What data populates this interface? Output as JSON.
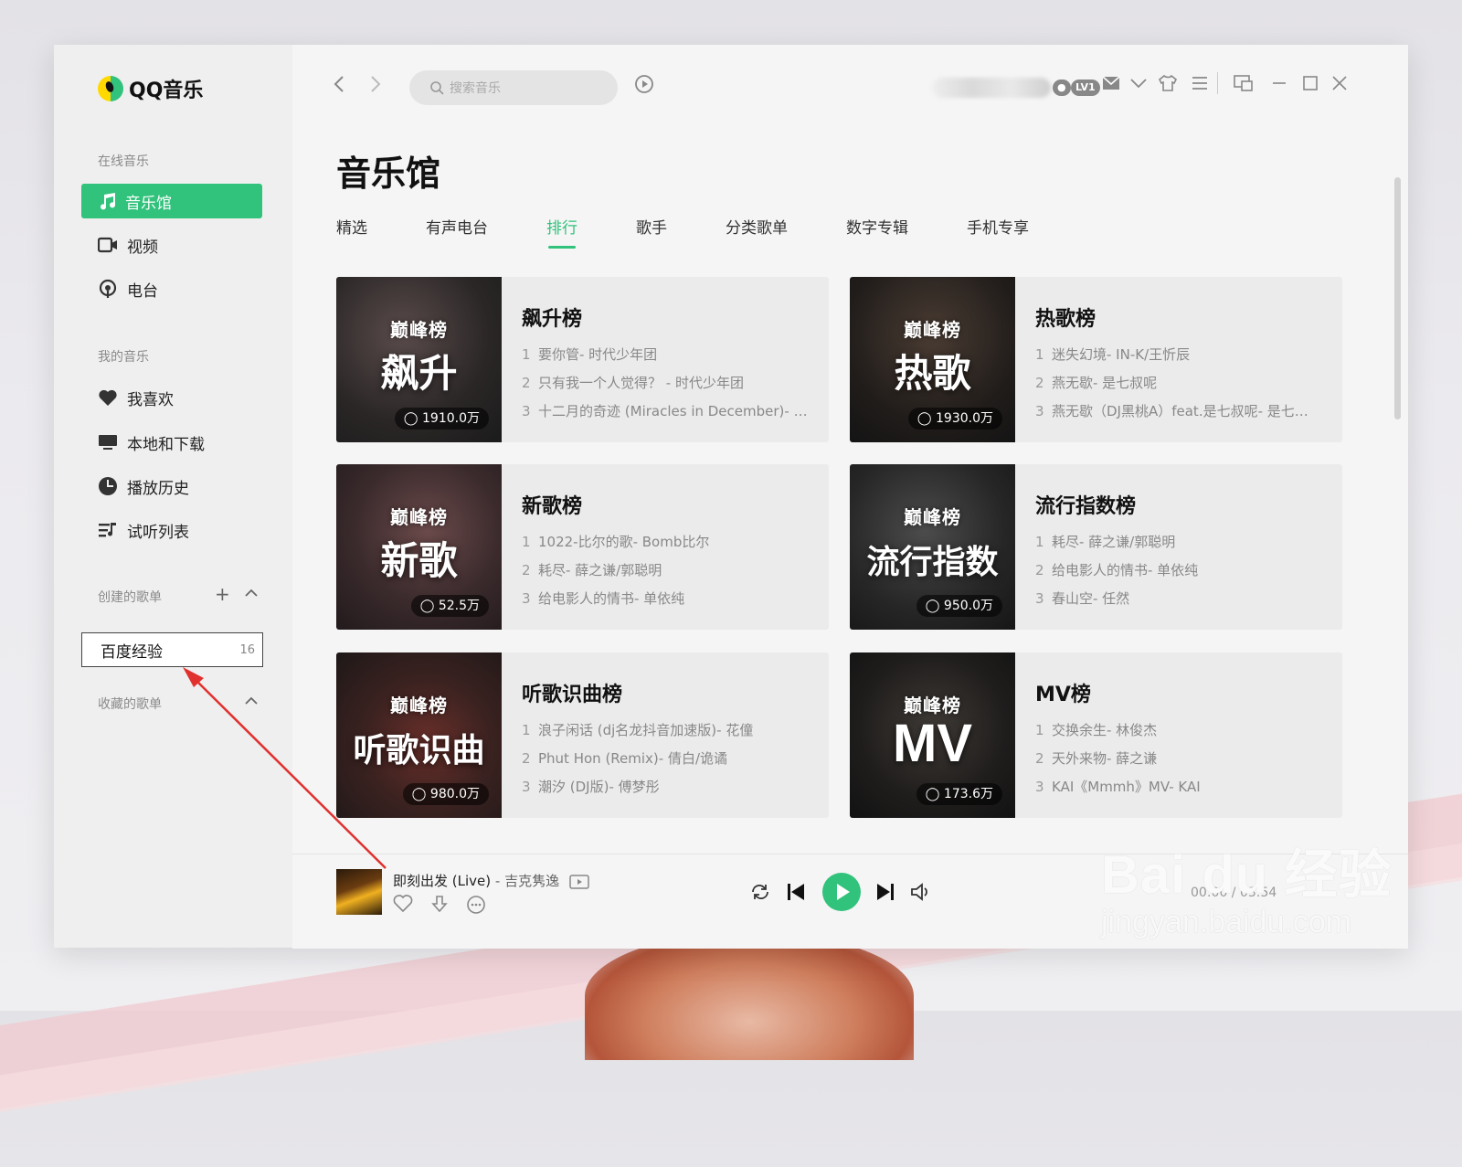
{
  "app": {
    "name": "QQ音乐"
  },
  "sidebar": {
    "online_title": "在线音乐",
    "online_items": [
      {
        "label": "音乐馆",
        "icon": "music-note-icon"
      },
      {
        "label": "视频",
        "icon": "video-icon"
      },
      {
        "label": "电台",
        "icon": "radio-icon"
      }
    ],
    "my_title": "我的音乐",
    "my_items": [
      {
        "label": "我喜欢",
        "icon": "heart-icon"
      },
      {
        "label": "本地和下载",
        "icon": "monitor-icon"
      },
      {
        "label": "播放历史",
        "icon": "clock-icon"
      },
      {
        "label": "试听列表",
        "icon": "list-icon"
      }
    ],
    "created_title": "创建的歌单",
    "created_playlist": {
      "name": "百度经验",
      "count": "16"
    },
    "collected_title": "收藏的歌单"
  },
  "topbar": {
    "search_placeholder": "搜索音乐",
    "badge_lv": "LV1"
  },
  "page": {
    "title": "音乐馆",
    "tabs": [
      "精选",
      "有声电台",
      "排行",
      "歌手",
      "分类歌单",
      "数字专辑",
      "手机专享"
    ],
    "active_tab": "排行"
  },
  "charts": [
    {
      "title": "飙升榜",
      "cover_brand": "巅峰榜",
      "cover_word": "飙升",
      "plays": "1910.0万",
      "songs": [
        "要你管- 时代少年团",
        "只有我一个人觉得？ - 时代少年团",
        "十二月的奇迹 (Miracles in December)- …"
      ]
    },
    {
      "title": "热歌榜",
      "cover_brand": "巅峰榜",
      "cover_word": "热歌",
      "plays": "1930.0万",
      "songs": [
        "迷失幻境- IN-K/王忻辰",
        "燕无歇- 是七叔呢",
        "燕无歇（DJ黑桃A）feat.是七叔呢- 是七…"
      ]
    },
    {
      "title": "新歌榜",
      "cover_brand": "巅峰榜",
      "cover_word": "新歌",
      "plays": "52.5万",
      "songs": [
        "1022-比尔的歌- Bomb比尔",
        "耗尽- 薛之谦/郭聪明",
        "给电影人的情书- 单依纯"
      ]
    },
    {
      "title": "流行指数榜",
      "cover_brand": "巅峰榜",
      "cover_word": "流行指数",
      "plays": "950.0万",
      "songs": [
        "耗尽- 薛之谦/郭聪明",
        "给电影人的情书- 单依纯",
        "春山空- 任然"
      ]
    },
    {
      "title": "听歌识曲榜",
      "cover_brand": "巅峰榜",
      "cover_word": "听歌识曲",
      "plays": "980.0万",
      "songs": [
        "浪子闲话 (dj名龙抖音加速版)- 花僮",
        "Phut Hon (Remix)- 倩白/诡谲",
        "潮汐 (DJ版)- 傅梦彤"
      ]
    },
    {
      "title": "MV榜",
      "cover_brand": "巅峰榜",
      "cover_word": "MV",
      "plays": "173.6万",
      "songs": [
        "交换余生- 林俊杰",
        "天外来物- 薛之谦",
        "KAI《Mmmh》MV- KAI"
      ]
    }
  ],
  "player": {
    "title": "即刻出发 (Live)",
    "artist": "吉克隽逸",
    "time": "00:00 / 03:54"
  },
  "watermark": {
    "main": "Bai du 经验",
    "sub": "jingyan.baidu.com"
  },
  "colors": {
    "accent": "#31c27c"
  }
}
